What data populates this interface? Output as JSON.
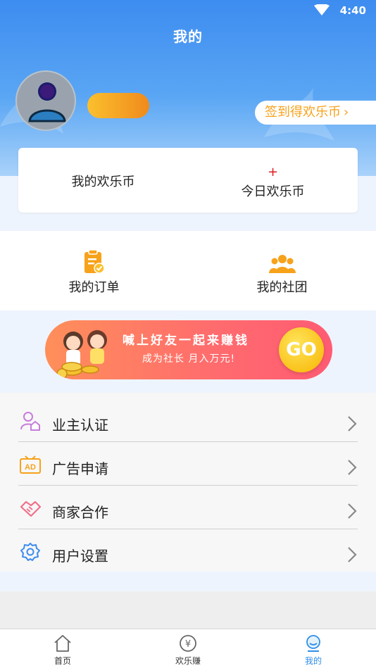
{
  "status_bar": {
    "time": "4:40"
  },
  "header": {
    "title": "我的",
    "checkin_label": "签到得欢乐币",
    "checkin_chevron": "›"
  },
  "coins": {
    "my_coins_label": "我的欢乐币",
    "today_value": "+",
    "today_label": "今日欢乐币"
  },
  "shortcuts": [
    {
      "label": "我的订单",
      "icon": "clipboard-check-icon"
    },
    {
      "label": "我的社团",
      "icon": "group-icon"
    }
  ],
  "banner": {
    "title": "喊上好友一起来赚钱",
    "subtitle": "成为社长  月入万元!",
    "go_label": "GO"
  },
  "menu": [
    {
      "label": "业主认证",
      "icon": "owner-verify-icon"
    },
    {
      "label": "广告申请",
      "icon": "ad-icon"
    },
    {
      "label": "商家合作",
      "icon": "handshake-icon"
    },
    {
      "label": "用户设置",
      "icon": "settings-gear-icon"
    }
  ],
  "tabs": [
    {
      "label": "首页",
      "icon": "home-icon"
    },
    {
      "label": "欢乐赚",
      "icon": "yen-coin-icon"
    },
    {
      "label": "我的",
      "icon": "profile-icon",
      "active": true
    }
  ],
  "colors": {
    "header_blue": "#3d8cf0",
    "accent_orange": "#f7a21b",
    "active_tab": "#2f8ee8",
    "coin_red": "#e0191c"
  }
}
